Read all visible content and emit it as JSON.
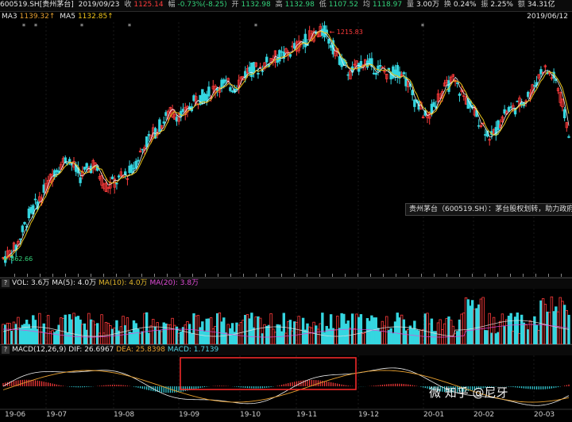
{
  "info": {
    "code": "600519.SH[贵州茅台]",
    "date": "2019/09/23",
    "close_label": "收",
    "close": "1125.14",
    "change_label": "幅",
    "change": "-0.73%(-8.25)",
    "open_label": "开",
    "open": "1132.98",
    "high_label": "高",
    "high": "1132.98",
    "low_label": "低",
    "low": "1107.52",
    "avg_label": "均",
    "avg": "1118.97",
    "vol_label": "量",
    "vol": "3.00万",
    "turn_label": "换",
    "turn": "0.24%",
    "amp_label": "振",
    "amp": "2.25%",
    "amt_label": "额",
    "amt": "34.31亿",
    "top_right_date": "2019/06/12"
  },
  "ma": {
    "ma3_label": "MA3",
    "ma3": "1139.32↑",
    "ma5_label": "MA5",
    "ma5": "1132.85↑"
  },
  "annotations": {
    "high_label": "1215.83",
    "low_label": "862.66"
  },
  "tooltip": "贵州茅台（600519.SH）：茅台股权划转，助力政府融资",
  "vol_header": {
    "q": "?",
    "vol": "VOL: 3.6万",
    "ma5": "MA(5): 4.0万",
    "ma10": "MA(10): 4.0万",
    "ma20": "MA(20): 3.8万"
  },
  "macd_header": {
    "q": "?",
    "name": "MACD(12,26,9)",
    "dif": "DIF: 26.6967",
    "dea": "DEA: 25.8398",
    "macd": "MACD: 1.7139"
  },
  "x_axis": [
    "19-06",
    "19-07",
    "19-08",
    "19-09",
    "19-10",
    "19-11",
    "19-12",
    "20-01",
    "20-02",
    "20-03"
  ],
  "watermark": "微  知乎 @尼牙",
  "colors": {
    "up": "#ff3b3b",
    "down": "#35d6e0",
    "ma3": "#f0f0f0",
    "ma5": "#e8c21a",
    "dif": "#f0f0f0",
    "dea": "#e8a02f",
    "highlight": "#ff2a2a"
  },
  "chart_data": {
    "type": "candlestick",
    "title": "600519.SH 贵州茅台",
    "price_range": [
      862.66,
      1215.83
    ],
    "marked_high": 1215.83,
    "marked_low": 862.66,
    "price_trend": [
      [
        0,
        863
      ],
      [
        6,
        880
      ],
      [
        12,
        930
      ],
      [
        18,
        960
      ],
      [
        24,
        1000
      ],
      [
        30,
        1020
      ],
      [
        36,
        990
      ],
      [
        42,
        1010
      ],
      [
        48,
        975
      ],
      [
        54,
        985
      ],
      [
        60,
        1000
      ],
      [
        66,
        1040
      ],
      [
        72,
        1065
      ],
      [
        78,
        1090
      ],
      [
        84,
        1085
      ],
      [
        90,
        1110
      ],
      [
        96,
        1120
      ],
      [
        102,
        1135
      ],
      [
        108,
        1130
      ],
      [
        114,
        1155
      ],
      [
        120,
        1160
      ],
      [
        126,
        1175
      ],
      [
        132,
        1180
      ],
      [
        138,
        1195
      ],
      [
        144,
        1210
      ],
      [
        150,
        1216
      ],
      [
        156,
        1180
      ],
      [
        162,
        1150
      ],
      [
        168,
        1170
      ],
      [
        174,
        1160
      ],
      [
        180,
        1150
      ],
      [
        186,
        1155
      ],
      [
        192,
        1110
      ],
      [
        198,
        1080
      ],
      [
        204,
        1120
      ],
      [
        210,
        1140
      ],
      [
        216,
        1110
      ],
      [
        222,
        1080
      ],
      [
        228,
        1050
      ],
      [
        234,
        1090
      ],
      [
        240,
        1100
      ],
      [
        246,
        1120
      ],
      [
        252,
        1160
      ],
      [
        258,
        1140
      ],
      [
        264,
        1060
      ]
    ],
    "volume_range_wan": [
      0,
      12
    ],
    "macd": {
      "dif": 26.6967,
      "dea": 25.8398,
      "macd": 1.7139
    },
    "highlight_box": [
      "19-09",
      "19-11"
    ]
  }
}
